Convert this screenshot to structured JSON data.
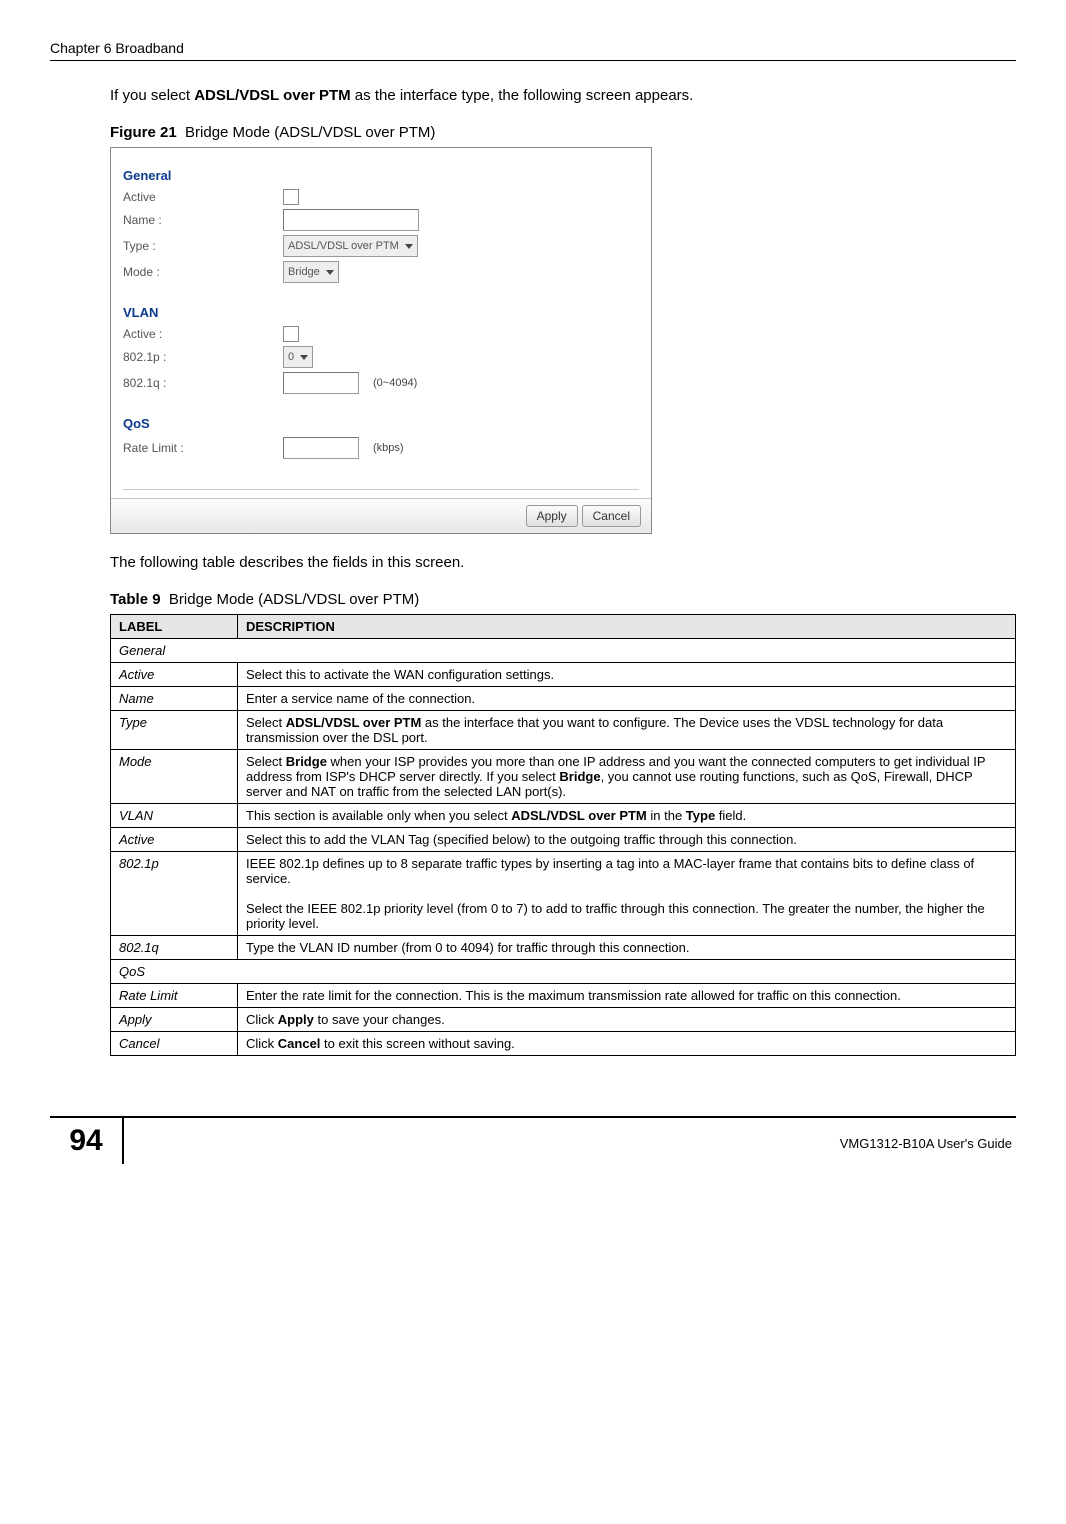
{
  "header": {
    "chapter": "Chapter 6 Broadband"
  },
  "intro": {
    "pre": "If you select ",
    "bold1": "ADSL/VDSL over PTM",
    "post": " as the interface type, the following screen appears."
  },
  "figure": {
    "label": "Figure 21",
    "caption": "Bridge Mode (ADSL/VDSL over PTM)"
  },
  "screenshot": {
    "sections": {
      "general": {
        "title": "General",
        "active_label": "Active",
        "name_label": "Name :",
        "type_label": "Type :",
        "type_value": "ADSL/VDSL over PTM",
        "mode_label": "Mode :",
        "mode_value": "Bridge"
      },
      "vlan": {
        "title": "VLAN",
        "active_label": "Active :",
        "p_label": "802.1p :",
        "p_value": "0",
        "q_label": "802.1q :",
        "q_hint": "(0~4094)"
      },
      "qos": {
        "title": "QoS",
        "rate_label": "Rate Limit :",
        "rate_hint": "(kbps)"
      }
    },
    "buttons": {
      "apply": "Apply",
      "cancel": "Cancel"
    }
  },
  "after_fig": "The following table describes the fields in this screen.",
  "table": {
    "label": "Table 9",
    "caption": "Bridge Mode (ADSL/VDSL over PTM)",
    "headers": {
      "label": "LABEL",
      "desc": "DESCRIPTION"
    },
    "rows": {
      "general": {
        "label": "General"
      },
      "active_g": {
        "label": "Active",
        "desc": "Select this to activate the WAN configuration settings."
      },
      "name": {
        "label": "Name",
        "desc": "Enter a service name of the connection."
      },
      "type": {
        "label": "Type",
        "pre": "Select ",
        "bold": "ADSL/VDSL over PTM",
        "post": " as the interface that you want to configure. The Device uses the VDSL technology for data transmission over the DSL port."
      },
      "mode": {
        "label": "Mode",
        "pre": "Select ",
        "bold1": "Bridge",
        "mid": " when your ISP provides you more than one IP address and you want the connected computers to get individual IP address from ISP's DHCP server directly. If you select ",
        "bold2": "Bridge",
        "post": ", you cannot use routing functions, such as QoS, Firewall, DHCP server and NAT on traffic from the selected LAN port(s)."
      },
      "vlan": {
        "label": "VLAN",
        "pre": "This section is available only when you select ",
        "bold1": "ADSL/VDSL over PTM",
        "mid": " in the ",
        "bold2": "Type",
        "post": " field."
      },
      "active_v": {
        "label": "Active",
        "desc": "Select this to add the VLAN Tag (specified below) to the outgoing traffic through this connection."
      },
      "p": {
        "label": "802.1p",
        "para1": "IEEE 802.1p defines up to 8 separate traffic types by inserting a tag into a MAC-layer frame that contains bits to define class of service.",
        "para2": "Select the IEEE 802.1p priority level (from 0 to 7) to add to traffic through this connection. The greater the number, the higher the priority level."
      },
      "q": {
        "label": "802.1q",
        "desc": "Type the VLAN ID number (from 0 to 4094) for traffic through this connection."
      },
      "qos": {
        "label": "QoS"
      },
      "rate": {
        "label": "Rate Limit",
        "desc": "Enter the rate limit for the connection. This is the maximum transmission rate allowed for traffic on this connection."
      },
      "apply": {
        "label": "Apply",
        "pre": "Click ",
        "bold": "Apply",
        "post": " to save your changes."
      },
      "cancel": {
        "label": "Cancel",
        "pre": "Click ",
        "bold": "Cancel",
        "post": " to exit this screen without saving."
      }
    }
  },
  "footer": {
    "page_number": "94",
    "guide": "VMG1312-B10A User's Guide"
  }
}
